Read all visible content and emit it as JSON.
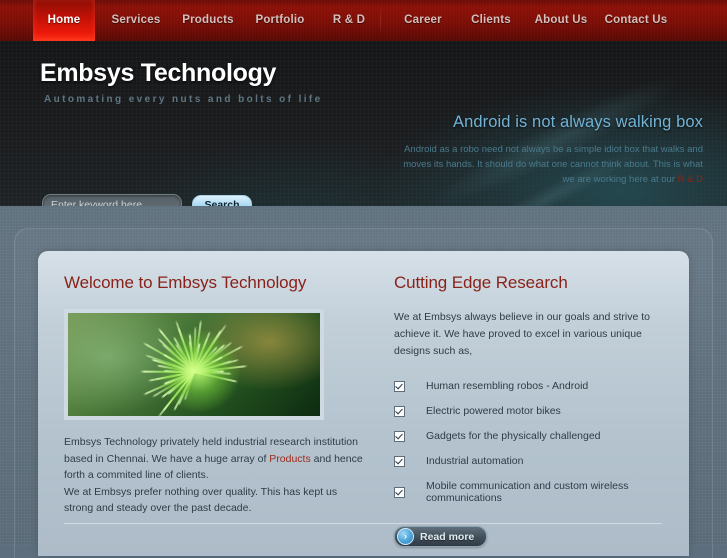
{
  "nav": {
    "items": [
      {
        "label": "Home",
        "active": true
      },
      {
        "label": "Services",
        "active": false
      },
      {
        "label": "Products",
        "active": false
      },
      {
        "label": "Portfolio",
        "active": false
      },
      {
        "label": "R & D",
        "active": false
      },
      {
        "label": "Career",
        "active": false
      },
      {
        "label": "Clients",
        "active": false
      },
      {
        "label": "About Us",
        "active": false
      },
      {
        "label": "Contact Us",
        "active": false
      }
    ]
  },
  "banner": {
    "logo_title": "Embsys Technology",
    "logo_tagline": "Automating every nuts and bolts of life",
    "search": {
      "placeholder": "Enter keyword here...",
      "value": "",
      "button_label": "Search"
    },
    "promo": {
      "heading": "Android is not always walking box",
      "body_before": "Android as a robo need not always be a simple idiot box that walks and moves its hands. It should do what one cannot think about. This is what we are working here at our ",
      "link_label": "R & D"
    }
  },
  "main": {
    "left": {
      "title": "Welcome to Embsys Technology",
      "image_alt": "green-radial-flower-photo",
      "paragraph_1_before": "Embsys Technology privately held industrial research institution based in Chennai. We have a huge array of ",
      "paragraph_1_link": "Products",
      "paragraph_1_after": " and hence forth a commited line of clients.",
      "paragraph_2": "We at Embsys prefer nothing over quality. This has kept us strong and steady over the past decade."
    },
    "right": {
      "title": "Cutting Edge Research",
      "intro": "We at Embsys always believe in our goals and strive to achieve it. We have proved to excel in various unique designs such as,",
      "checklist": [
        "Human resembling robos - Android",
        "Electric powered motor bikes",
        "Gadgets for the physically challenged",
        "Industrial automation",
        "Mobile communication and custom wireless communications"
      ],
      "read_more_label": "Read more",
      "read_more_icon": "›"
    }
  },
  "colors": {
    "nav_red": "#8d1108",
    "nav_active_red": "#e8190a",
    "heading_red": "#8a2219",
    "link_red": "#a12a1c",
    "banner_blue": "#72b3d6",
    "panel_bg": "#b4c3ce"
  }
}
